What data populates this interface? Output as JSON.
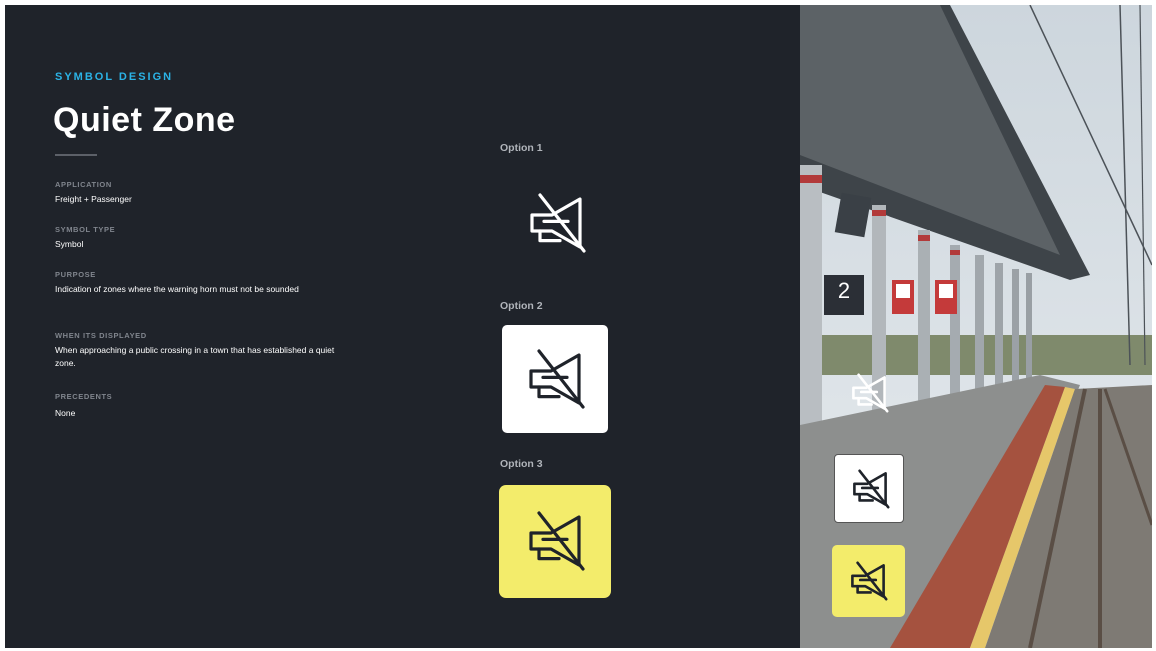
{
  "header": {
    "eyebrow": "SYMBOL DESIGN",
    "title": "Quiet Zone"
  },
  "details": [
    {
      "label": "APPLICATION",
      "value": "Freight + Passenger"
    },
    {
      "label": "SYMBOL TYPE",
      "value": "Symbol"
    },
    {
      "label": "PURPOSE",
      "value": "Indication of zones where the warning horn must not be sounded"
    },
    {
      "label": "WHEN ITS DISPLAYED",
      "value": "When approaching a public crossing in a town that has established a quiet zone."
    },
    {
      "label": "PRECEDENTS",
      "value": "None"
    }
  ],
  "options": [
    {
      "label": "Option 1",
      "style": "outline on dark"
    },
    {
      "label": "Option 2",
      "style": "white card"
    },
    {
      "label": "Option 3",
      "style": "yellow card"
    }
  ],
  "photo": {
    "platform_number": "2"
  },
  "colors": {
    "panel": "#1f232a",
    "accent": "#2bb3e6",
    "yellow": "#f3ec6b"
  },
  "icons": [
    "no-horn-icon"
  ]
}
